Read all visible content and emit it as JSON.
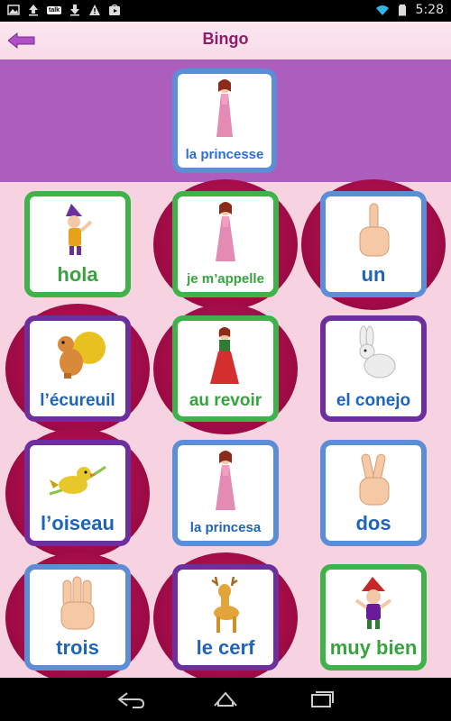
{
  "status_bar": {
    "time": "5:28",
    "talk_label": "talk"
  },
  "header": {
    "title": "Bingo"
  },
  "target": {
    "label": "la princesse",
    "icon": "princess-icon"
  },
  "grid": [
    {
      "label": "hola",
      "icon": "gnome-icon",
      "color": "green"
    },
    {
      "label": "je m’appelle",
      "icon": "princess-icon",
      "color": "green"
    },
    {
      "label": "un",
      "icon": "one-finger-hand-icon",
      "color": "blue"
    },
    {
      "label": "l’écureuil",
      "icon": "squirrel-icon",
      "color": "purple"
    },
    {
      "label": "au revoir",
      "icon": "red-dress-lady-icon",
      "color": "green"
    },
    {
      "label": "el conejo",
      "icon": "rabbit-icon",
      "color": "purple"
    },
    {
      "label": "l’oiseau",
      "icon": "bird-icon",
      "color": "purple"
    },
    {
      "label": "la princesa",
      "icon": "princess-icon",
      "color": "blue"
    },
    {
      "label": "dos",
      "icon": "two-fingers-hand-icon",
      "color": "blue"
    },
    {
      "label": "trois",
      "icon": "three-fingers-hand-icon",
      "color": "blue"
    },
    {
      "label": "le cerf",
      "icon": "deer-icon",
      "color": "purple"
    },
    {
      "label": "muy bien",
      "icon": "elf-icon",
      "color": "green"
    }
  ],
  "colors": {
    "green": "#3fb34a",
    "blue": "#5b8ed6",
    "purple": "#6d2f9e",
    "target_band": "#ad5dbc",
    "background": "#f7d3e2"
  }
}
